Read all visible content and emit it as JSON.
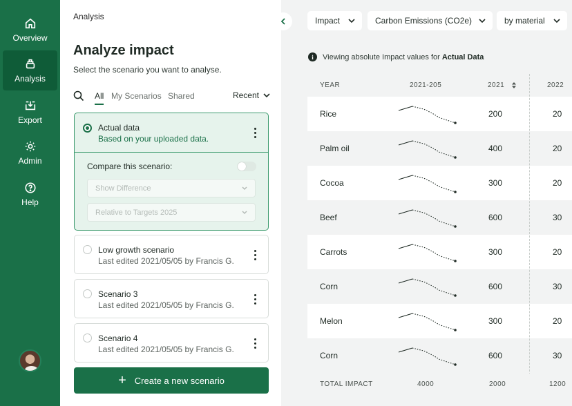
{
  "sidebar": {
    "items": [
      {
        "label": "Overview",
        "icon": "home-icon"
      },
      {
        "label": "Analysis",
        "icon": "layers-icon"
      },
      {
        "label": "Export",
        "icon": "export-icon"
      },
      {
        "label": "Admin",
        "icon": "gear-icon"
      },
      {
        "label": "Help",
        "icon": "help-icon"
      }
    ],
    "active": "Analysis",
    "accent": "#1a7048"
  },
  "panel": {
    "breadcrumb": "Analysis",
    "title": "Analyze impact",
    "subtitle": "Select the scenario you want to analyse.",
    "tabs": [
      "All",
      "My Scenarios",
      "Shared"
    ],
    "active_tab": "All",
    "sort_label": "Recent",
    "scenarios": [
      {
        "title": "Actual data",
        "subtitle": "Based on your uploaded data.",
        "selected": true
      },
      {
        "title": "Low growth scenario",
        "subtitle": "Last edited 2021/05/05 by Francis G.",
        "selected": false
      },
      {
        "title": "Scenario 3",
        "subtitle": "Last edited 2021/05/05 by Francis G.",
        "selected": false
      },
      {
        "title": "Scenario 4",
        "subtitle": "Last edited 2021/05/05 by Francis G.",
        "selected": false
      }
    ],
    "compare_label": "Compare this scenario:",
    "compare_toggle_on": false,
    "compare_select_1": "Show Difference",
    "compare_select_2": "Relative to Targets 2025",
    "create_label": "Create a new scenario"
  },
  "main": {
    "dropdowns": [
      "Impact",
      "Carbon Emissions (CO2e)",
      "by material"
    ],
    "info_prefix": "Viewing absolute Impact values for",
    "info_strong": "Actual Data",
    "table": {
      "headers": [
        "YEAR",
        "2021-205",
        "2021",
        "2022"
      ],
      "rows": [
        {
          "name": "Rice",
          "v2021": "200",
          "v2022": "20"
        },
        {
          "name": "Palm oil",
          "v2021": "400",
          "v2022": "20"
        },
        {
          "name": "Cocoa",
          "v2021": "300",
          "v2022": "20"
        },
        {
          "name": "Beef",
          "v2021": "600",
          "v2022": "30"
        },
        {
          "name": "Carrots",
          "v2021": "300",
          "v2022": "20"
        },
        {
          "name": "Corn",
          "v2021": "600",
          "v2022": "30"
        },
        {
          "name": "Melon",
          "v2021": "300",
          "v2022": "20"
        },
        {
          "name": "Corn",
          "v2021": "600",
          "v2022": "30"
        }
      ],
      "total": {
        "label": "TOTAL IMPACT",
        "range": "4000",
        "v2021": "2000",
        "v2022": "1200"
      }
    }
  }
}
